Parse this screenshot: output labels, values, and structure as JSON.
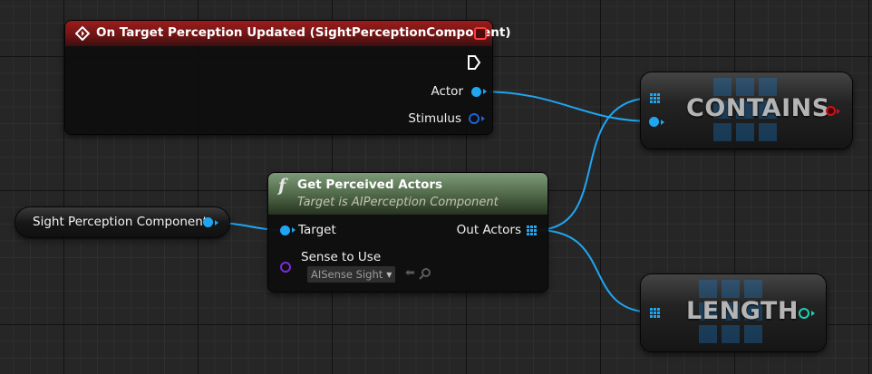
{
  "colors": {
    "exec_header": "#8a1a1a",
    "function_header": "#627d5a",
    "object_pin": "#1fa6f2",
    "struct_pin": "#1b63d9",
    "class_pin": "#7b2ae0",
    "int_pin": "#19d3b4",
    "bool_pin": "#c9141b"
  },
  "event_node": {
    "title": "On Target Perception Updated (SightPerceptionComponent)",
    "icon": "event-diamond-icon",
    "pins": {
      "actor": "Actor",
      "stimulus": "Stimulus"
    }
  },
  "sight_node": {
    "label": "Sight Perception Component"
  },
  "get_node": {
    "icon": "function-icon",
    "title": "Get Perceived Actors",
    "subtitle": "Target is AIPerception Component",
    "pins": {
      "target": "Target",
      "sense": "Sense to Use",
      "out": "Out Actors"
    },
    "sense_value": "AISense Sight"
  },
  "contains_node": {
    "title": "CONTAINS"
  },
  "length_node": {
    "title": "LENGTH"
  }
}
